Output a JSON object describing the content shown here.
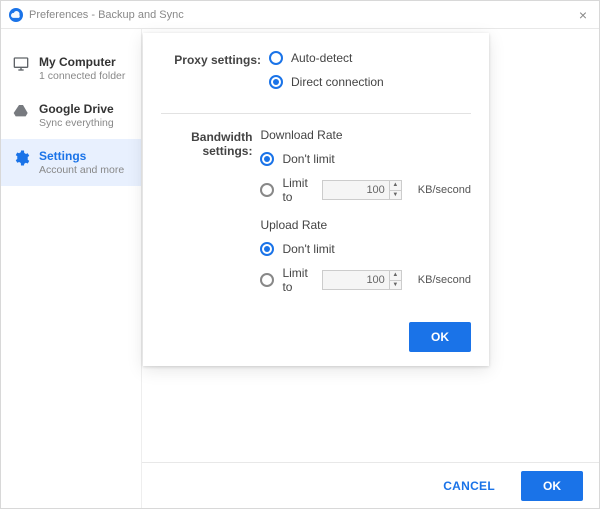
{
  "window": {
    "title": "Preferences - Backup and Sync"
  },
  "sidebar": {
    "items": [
      {
        "title": "My Computer",
        "subtitle": "1 connected folder"
      },
      {
        "title": "Google Drive",
        "subtitle": "Sync everything"
      },
      {
        "title": "Settings",
        "subtitle": "Account and more"
      }
    ]
  },
  "dialog": {
    "proxy_label": "Proxy settings:",
    "proxy_auto": "Auto-detect",
    "proxy_direct": "Direct connection",
    "bandwidth_label": "Bandwidth settings:",
    "download_title": "Download Rate",
    "upload_title": "Upload Rate",
    "dont_limit": "Don't limit",
    "limit_to": "Limit to",
    "download_value": "100",
    "upload_value": "100",
    "unit": "KB/second",
    "ok": "OK"
  },
  "footer": {
    "cancel": "CANCEL",
    "ok": "OK"
  }
}
